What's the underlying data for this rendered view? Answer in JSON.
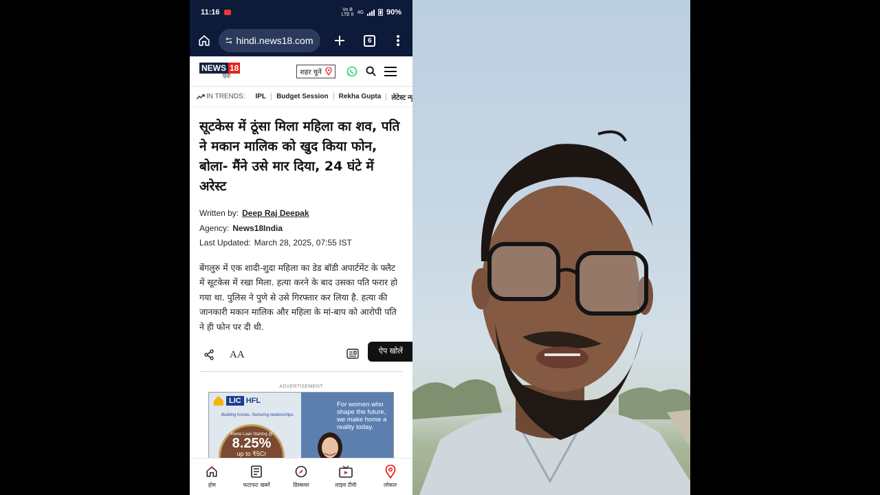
{
  "status_bar": {
    "time": "11:16",
    "network_label": "Vo B\nLTE II",
    "signal": "4G",
    "battery": "90%"
  },
  "browser": {
    "url": "hindi.news18.com",
    "tab_count": "6"
  },
  "site": {
    "logo": {
      "news": "NEWS",
      "n18": "18",
      "hindi": "हिंदी"
    },
    "city_selector": "शहर चुनें"
  },
  "trends": {
    "label": "IN TRENDS:",
    "items": [
      "IPL",
      "Budget Session",
      "Rekha Gupta",
      "लेटेस्ट न्यूज़"
    ]
  },
  "article": {
    "headline": "सूटकेस में ठूंसा मिला महिला का शव, पति ने मकान मालिक को खुद किया फोन, बोला- मैंने उसे मार दिया, 24 घंटे में अरेस्ट",
    "written_by_label": "Written by:",
    "author": "Deep Raj Deepak",
    "agency_label": "Agency:",
    "agency": "News18India",
    "updated_label": "Last Updated:",
    "updated": "March 28, 2025, 07:55 IST",
    "summary": "बेंगलुरु में एक शादी-शुदा महिला का डेड बॉडी अपार्टमेंट के फ्लैट में सूटकेस में रखा मिला. हत्या करने के बाद उसका पति फरार हो गया था. पुलिस ने पुणे से उसे गिरफ्तार कर लिया है. हत्या की जानकारी मकान मालिक और महिला के मां-बाप को आरोपी पति ने ही फोन पर दी थी."
  },
  "actions": {
    "font_size_label": "AA",
    "open_app": "ऐप खोलें"
  },
  "ad": {
    "label": "ADVERTISEMENT",
    "brand_lic": "LIC",
    "brand_hfl": "HFL",
    "tagline": "Building homes. Nurturing relationships.",
    "loan_text": "Home Loan Starting @",
    "rate": "8.25%",
    "upto": "up to ₹5Cr",
    "copy": [
      "For women who",
      "shape the future,",
      "we make home a",
      "reality today."
    ]
  },
  "bottom_nav": [
    {
      "label": "होम",
      "icon": "home-icon"
    },
    {
      "label": "फटाफट खबरें",
      "icon": "news-list-icon"
    },
    {
      "label": "डिस्कवर",
      "icon": "compass-icon"
    },
    {
      "label": "लाइव टीवी",
      "icon": "tv-icon"
    },
    {
      "label": "लोकल",
      "icon": "location-pin-icon"
    }
  ],
  "colors": {
    "browser_bar": "#0d1a3a",
    "brand_red": "#e2231a",
    "brand_navy": "#15223f",
    "whatsapp": "#25d366"
  }
}
